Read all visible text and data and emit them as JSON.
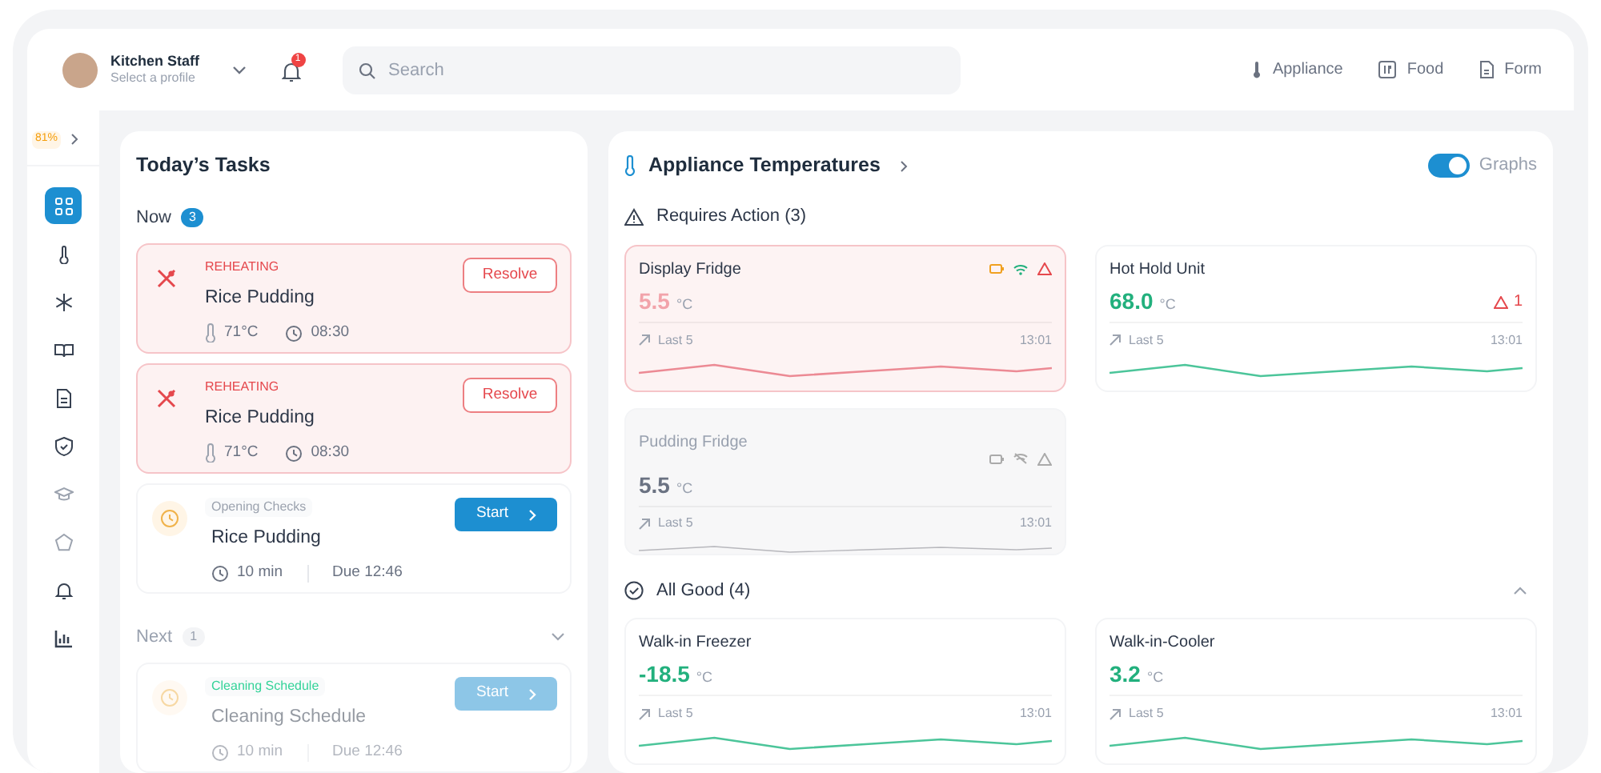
{
  "profile": {
    "name": "Kitchen Staff",
    "subtitle": "Select a profile"
  },
  "notifications": {
    "count": "1"
  },
  "search": {
    "placeholder": "Search"
  },
  "header_links": [
    {
      "label": "Appliance",
      "kind": "thermometer"
    },
    {
      "label": "Food",
      "kind": "food"
    },
    {
      "label": "Form",
      "kind": "form"
    }
  ],
  "sidebar": {
    "progress": "81%",
    "items": [
      {
        "kind": "grid",
        "selected": true
      },
      {
        "kind": "thermometer",
        "selected": false
      },
      {
        "kind": "snowflake",
        "selected": false
      },
      {
        "kind": "book",
        "selected": false
      },
      {
        "kind": "document",
        "selected": false
      },
      {
        "kind": "shield",
        "selected": false
      },
      {
        "kind": "cap",
        "selected": false
      },
      {
        "kind": "pentagon",
        "selected": false
      },
      {
        "kind": "bell",
        "selected": false
      },
      {
        "kind": "chart",
        "selected": false
      }
    ]
  },
  "tasks": {
    "title": "Today’s Tasks",
    "sections": [
      {
        "label": "Now",
        "count": "3",
        "highlighted": true,
        "collapsible": false,
        "items": [
          {
            "kind": "alert",
            "tag": "REHEATING",
            "name": "Rice Pudding",
            "temperature": "71°C",
            "time": "08:30",
            "action": "Resolve"
          },
          {
            "kind": "alert",
            "tag": "REHEATING",
            "name": "Rice Pudding",
            "temperature": "71°C",
            "time": "08:30",
            "action": "Resolve"
          },
          {
            "kind": "check",
            "tag": "Opening Checks",
            "color": "#9ca3af",
            "name": "Rice Pudding",
            "duration": "10 min",
            "due": "Due 12:46",
            "action": "Start",
            "dimmed": false
          }
        ]
      },
      {
        "label": "Next",
        "count": "1",
        "highlighted": false,
        "collapsible": true,
        "items": [
          {
            "kind": "check",
            "tag": "Cleaning Schedule",
            "color": "#34d399",
            "name": "Cleaning Schedule",
            "duration": "10 min",
            "due": "Due 12:46",
            "action": "Start",
            "dimmed": true
          }
        ]
      }
    ]
  },
  "appliances": {
    "title": "Appliance Temperatures",
    "graphs_toggle": {
      "label": "Graphs",
      "on": true
    },
    "groups": [
      {
        "label": "Requires Action (3)",
        "kind": "warning",
        "collapsible": false,
        "items": [
          {
            "name": "Display Fridge",
            "kind": "alert",
            "value": "5.5",
            "unit": "°C",
            "trend": "Last 5",
            "time": "13:01",
            "sensors": true
          },
          {
            "name": "Hot Hold Unit",
            "kind": "ok",
            "value": "68.0",
            "unit": "°C",
            "trend": "Last 5",
            "time": "13:01",
            "sensors": false,
            "alerts": "1"
          },
          {
            "name": "Pudding Fridge",
            "kind": "offline",
            "value": "5.5",
            "unit": "°C",
            "trend": "Last 5",
            "time": "13:01",
            "sensors": true
          }
        ]
      },
      {
        "label": "All Good (4)",
        "kind": "check",
        "collapsible": true,
        "items": [
          {
            "name": "Walk-in Freezer",
            "kind": "ok",
            "value": "-18.5",
            "unit": "°C",
            "trend": "Last 5",
            "time": "13:01",
            "sensors": false
          },
          {
            "name": "Walk-in-Cooler",
            "kind": "ok",
            "value": "3.2",
            "unit": "°C",
            "trend": "Last 5",
            "time": "13:01",
            "sensors": false
          }
        ]
      }
    ]
  }
}
